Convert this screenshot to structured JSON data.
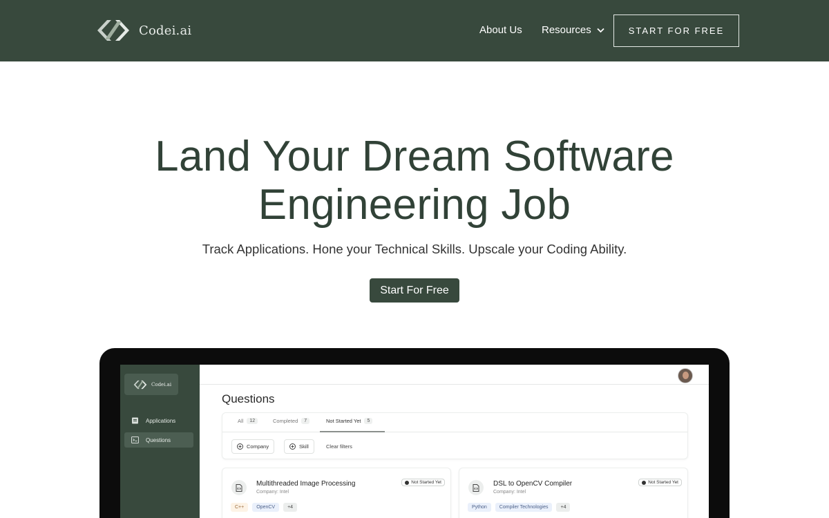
{
  "nav": {
    "brand": "Codei.ai",
    "links": {
      "about": "About Us",
      "resources": "Resources"
    },
    "cta": "START FOR FREE"
  },
  "hero": {
    "title_line1": "Land Your Dream Software",
    "title_line2": "Engineering Job",
    "subtitle": "Track Applications. Hone your Technical Skills. Upscale your Coding Ability.",
    "button": "Start For Free"
  },
  "app": {
    "brand": "Codei.ai",
    "sidebar": [
      {
        "label": "Applications",
        "icon": "document-icon"
      },
      {
        "label": "Questions",
        "icon": "terminal-icon"
      }
    ],
    "page_title": "Questions",
    "tabs": [
      {
        "label": "All",
        "count": "12"
      },
      {
        "label": "Completed",
        "count": "7"
      },
      {
        "label": "Not Started Yet",
        "count": "5"
      }
    ],
    "filters": {
      "company": "Company",
      "skill": "Skill",
      "clear": "Clear filters"
    },
    "questions": [
      {
        "title": "Multithreaded Image Processing",
        "company": "Company: Intel",
        "status": "Not Started Yet",
        "tags": [
          "C++",
          "OpenCV",
          "+4"
        ]
      },
      {
        "title": "DSL to OpenCV Compiler",
        "company": "Company: Intel",
        "status": "Not Started Yet",
        "tags": [
          "Python",
          "Compiler Technologies",
          "+4"
        ]
      }
    ]
  },
  "colors": {
    "brand_dark_green": "#38493d",
    "hero_text": "#314237"
  }
}
